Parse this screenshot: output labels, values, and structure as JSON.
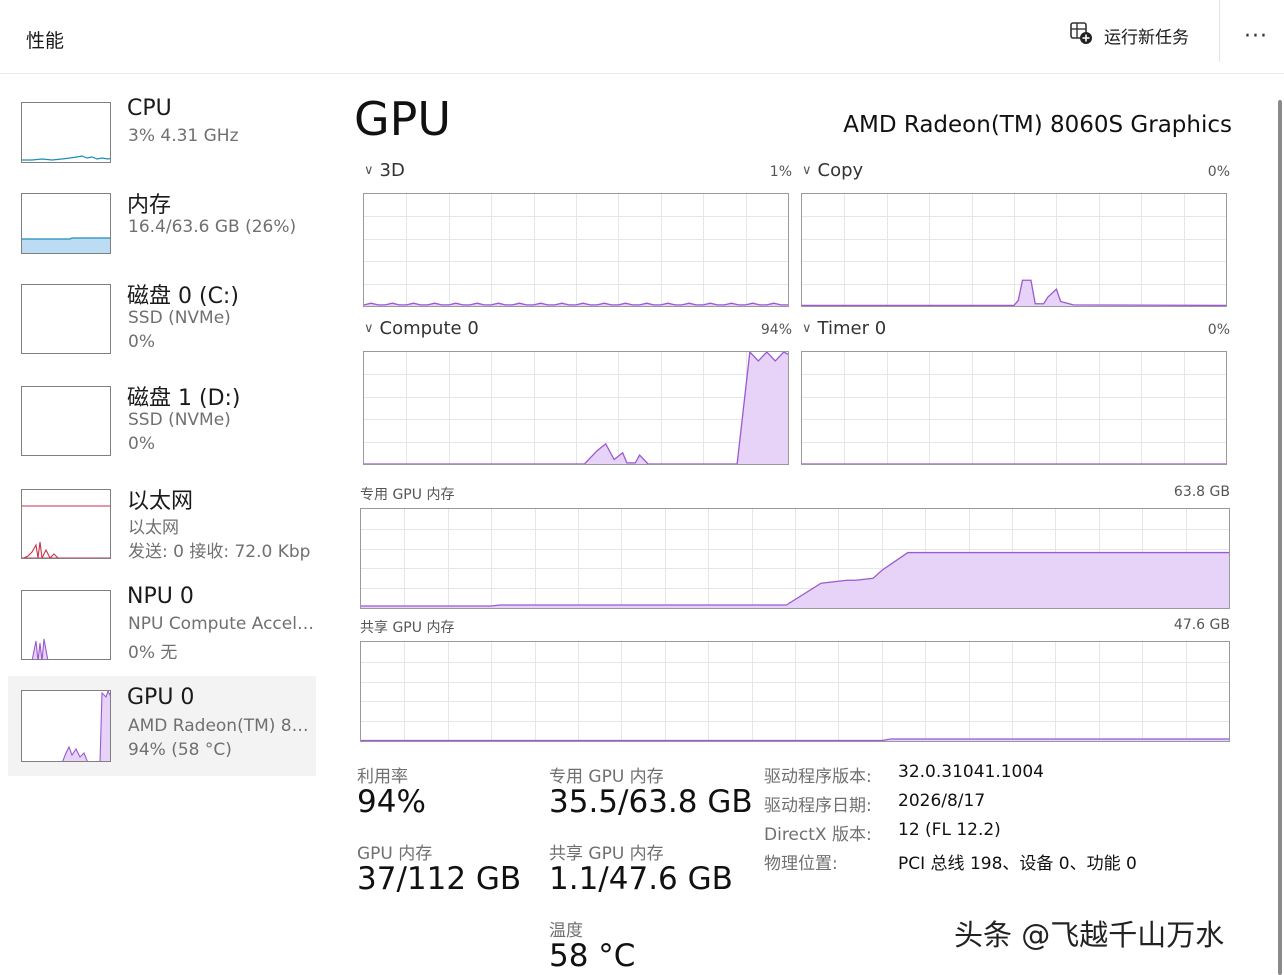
{
  "header": {
    "title": "性能",
    "run_task_label": "运行新任务",
    "more_label": "···"
  },
  "sidebar": {
    "items": [
      {
        "name": "CPU",
        "sub1": "3%  4.31 GHz",
        "sub2": ""
      },
      {
        "name": "内存",
        "sub1": "16.4/63.6 GB (26%)",
        "sub2": ""
      },
      {
        "name": "磁盘 0 (C:)",
        "sub1": "SSD (NVMe)",
        "sub2": "0%"
      },
      {
        "name": "磁盘 1 (D:)",
        "sub1": "SSD (NVMe)",
        "sub2": "0%"
      },
      {
        "name": "以太网",
        "sub1": "以太网",
        "sub2": "发送: 0 接收: 72.0 Kbp"
      },
      {
        "name": "NPU 0",
        "sub1": "NPU Compute Accel…",
        "sub2": "0% 无"
      },
      {
        "name": "GPU 0",
        "sub1": "AMD Radeon(TM) 8…",
        "sub2": "94%  (58 °C)"
      }
    ],
    "selected_index": 6
  },
  "main": {
    "title": "GPU",
    "model": "AMD Radeon(TM) 8060S Graphics",
    "engines": [
      {
        "label": "3D",
        "pct": "1%"
      },
      {
        "label": "Copy",
        "pct": "0%"
      },
      {
        "label": "Compute 0",
        "pct": "94%"
      },
      {
        "label": "Timer 0",
        "pct": "0%"
      }
    ],
    "dedicated_mem": {
      "label": "专用 GPU 内存",
      "max": "63.8 GB"
    },
    "shared_mem": {
      "label": "共享 GPU 内存",
      "max": "47.6 GB"
    }
  },
  "stats": {
    "utilization": {
      "label": "利用率",
      "value": "94%"
    },
    "dedicated": {
      "label": "专用 GPU 内存",
      "value": "35.5/63.8 GB"
    },
    "gpu_mem": {
      "label": "GPU 内存",
      "value": "37/112 GB"
    },
    "shared": {
      "label": "共享 GPU 内存",
      "value": "1.1/47.6 GB"
    },
    "temperature": {
      "label": "温度",
      "value": "58 °C"
    }
  },
  "info": [
    {
      "key": "驱动程序版本:",
      "value": "32.0.31041.1004"
    },
    {
      "key": "驱动程序日期:",
      "value": "2026/8/17"
    },
    {
      "key": "DirectX 版本:",
      "value": "12 (FL 12.2)"
    },
    {
      "key": "物理位置:",
      "value": "PCI 总线 198、设备 0、功能 0"
    }
  ],
  "watermark": "头条 @飞越千山万水",
  "colors": {
    "gpu_line": "#9b59d0",
    "gpu_fill": "#e6d3f7",
    "cpu_line": "#1c8fb8",
    "mem_fill": "#bcdcf3",
    "net_line": "#c8344c",
    "grid": "#e6e6e6"
  }
}
